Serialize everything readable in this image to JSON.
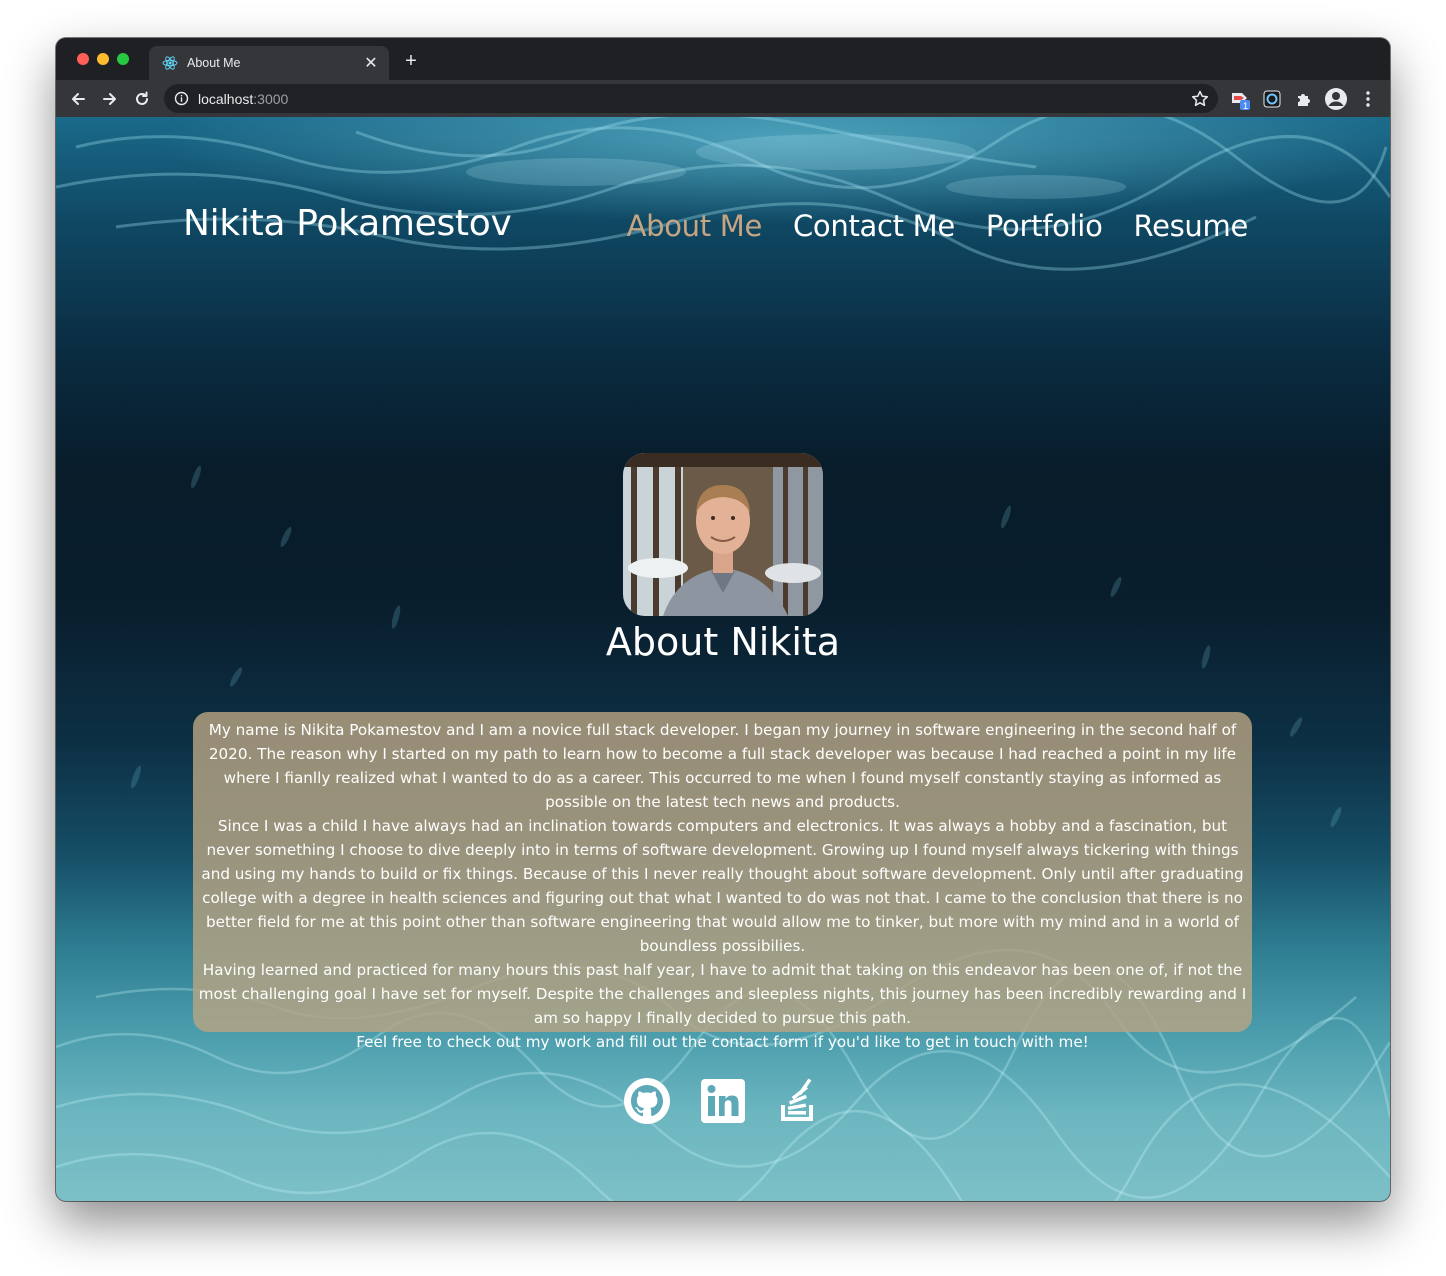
{
  "browser": {
    "tab_title": "About Me",
    "url_host": "localhost",
    "url_port": ":3000",
    "extension_badge": "1"
  },
  "site": {
    "brand": "Nikita Pokamestov",
    "nav": [
      {
        "label": "About Me",
        "active": true
      },
      {
        "label": "Contact Me",
        "active": false
      },
      {
        "label": "Portfolio",
        "active": false
      },
      {
        "label": "Resume",
        "active": false
      }
    ],
    "accent_color": "#c6a582"
  },
  "about": {
    "title": "About Nikita",
    "paragraphs": [
      "My name is Nikita Pokamestov and I am a novice full stack developer. I began my journey in software engineering in the second half of 2020. The reason why I started on my path to learn how to become a full stack developer was because I had reached a point in my life where I fianlly realized what I wanted to do as a career. This occurred to me when I found myself constantly staying as informed as possible on the latest tech news and products.",
      "Since I was a child I have always had an inclination towards computers and electronics. It was always a hobby and a fascination, but never something I choose to dive deeply into in terms of software development. Growing up I found myself always tickering with things and using my hands to build or fix things. Because of this I never really thought about software development. Only until after graduating college with a degree in health sciences and figuring out that what I wanted to do was not that. I came to the conclusion that there is no better field for me at this point other than software engineering that would allow me to tinker, but more with my mind and in a world of boundless possibilies.",
      "Having learned and practiced for many hours this past half year, I have to admit that taking on this endeavor has been one of, if not the most challenging goal I have set for myself. Despite the challenges and sleepless nights, this journey has been incredibly rewarding and I am so happy I finally decided to pursue this path.",
      "Feel free to check out my work and fill out the contact form if you'd like to get in touch with me!"
    ]
  },
  "socials": [
    {
      "icon": "github-icon"
    },
    {
      "icon": "linkedin-icon"
    },
    {
      "icon": "stackoverflow-icon"
    }
  ]
}
